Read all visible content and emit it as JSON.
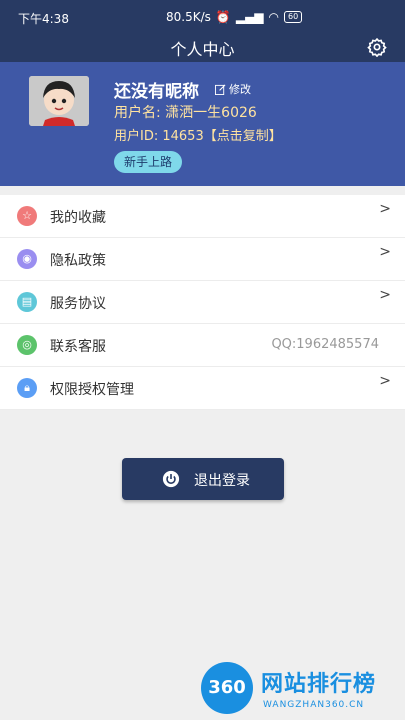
{
  "status_bar": {
    "time": "下午4:38",
    "network_speed": "80.5K/s",
    "battery": "60"
  },
  "header": {
    "title": "个人中心",
    "settings_icon": "gear-icon"
  },
  "profile": {
    "nickname": "还没有昵称",
    "edit_label": "修改",
    "username_line": "用户名: 潇洒一生6026",
    "userid_line": "用户ID: 14653【点击复制】",
    "badge": "新手上路"
  },
  "menu": {
    "items": [
      {
        "label": "我的收藏",
        "icon": "star-icon",
        "color": "#f07a7a",
        "chevron": ">",
        "right_text": ""
      },
      {
        "label": "隐私政策",
        "icon": "privacy-icon",
        "color": "#9a8ef0",
        "chevron": ">",
        "right_text": ""
      },
      {
        "label": "服务协议",
        "icon": "document-icon",
        "color": "#5ec7d8",
        "chevron": ">",
        "right_text": ""
      },
      {
        "label": "联系客服",
        "icon": "eye-icon",
        "color": "#5cc36b",
        "chevron": "",
        "right_text": "QQ:1962485574"
      },
      {
        "label": "权限授权管理",
        "icon": "lock-icon",
        "color": "#5b9ef5",
        "chevron": ">",
        "right_text": ""
      }
    ]
  },
  "logout": {
    "label": "退出登录",
    "icon": "power-icon"
  },
  "watermark": {
    "number": "360",
    "title": "网站排行榜",
    "domain": "WANGZHAN360.CN"
  },
  "colors": {
    "header_bg": "#283a63",
    "profile_bg": "#3f58a6",
    "badge_bg": "#7fd8ea",
    "accent_text": "#ffe3a0"
  }
}
